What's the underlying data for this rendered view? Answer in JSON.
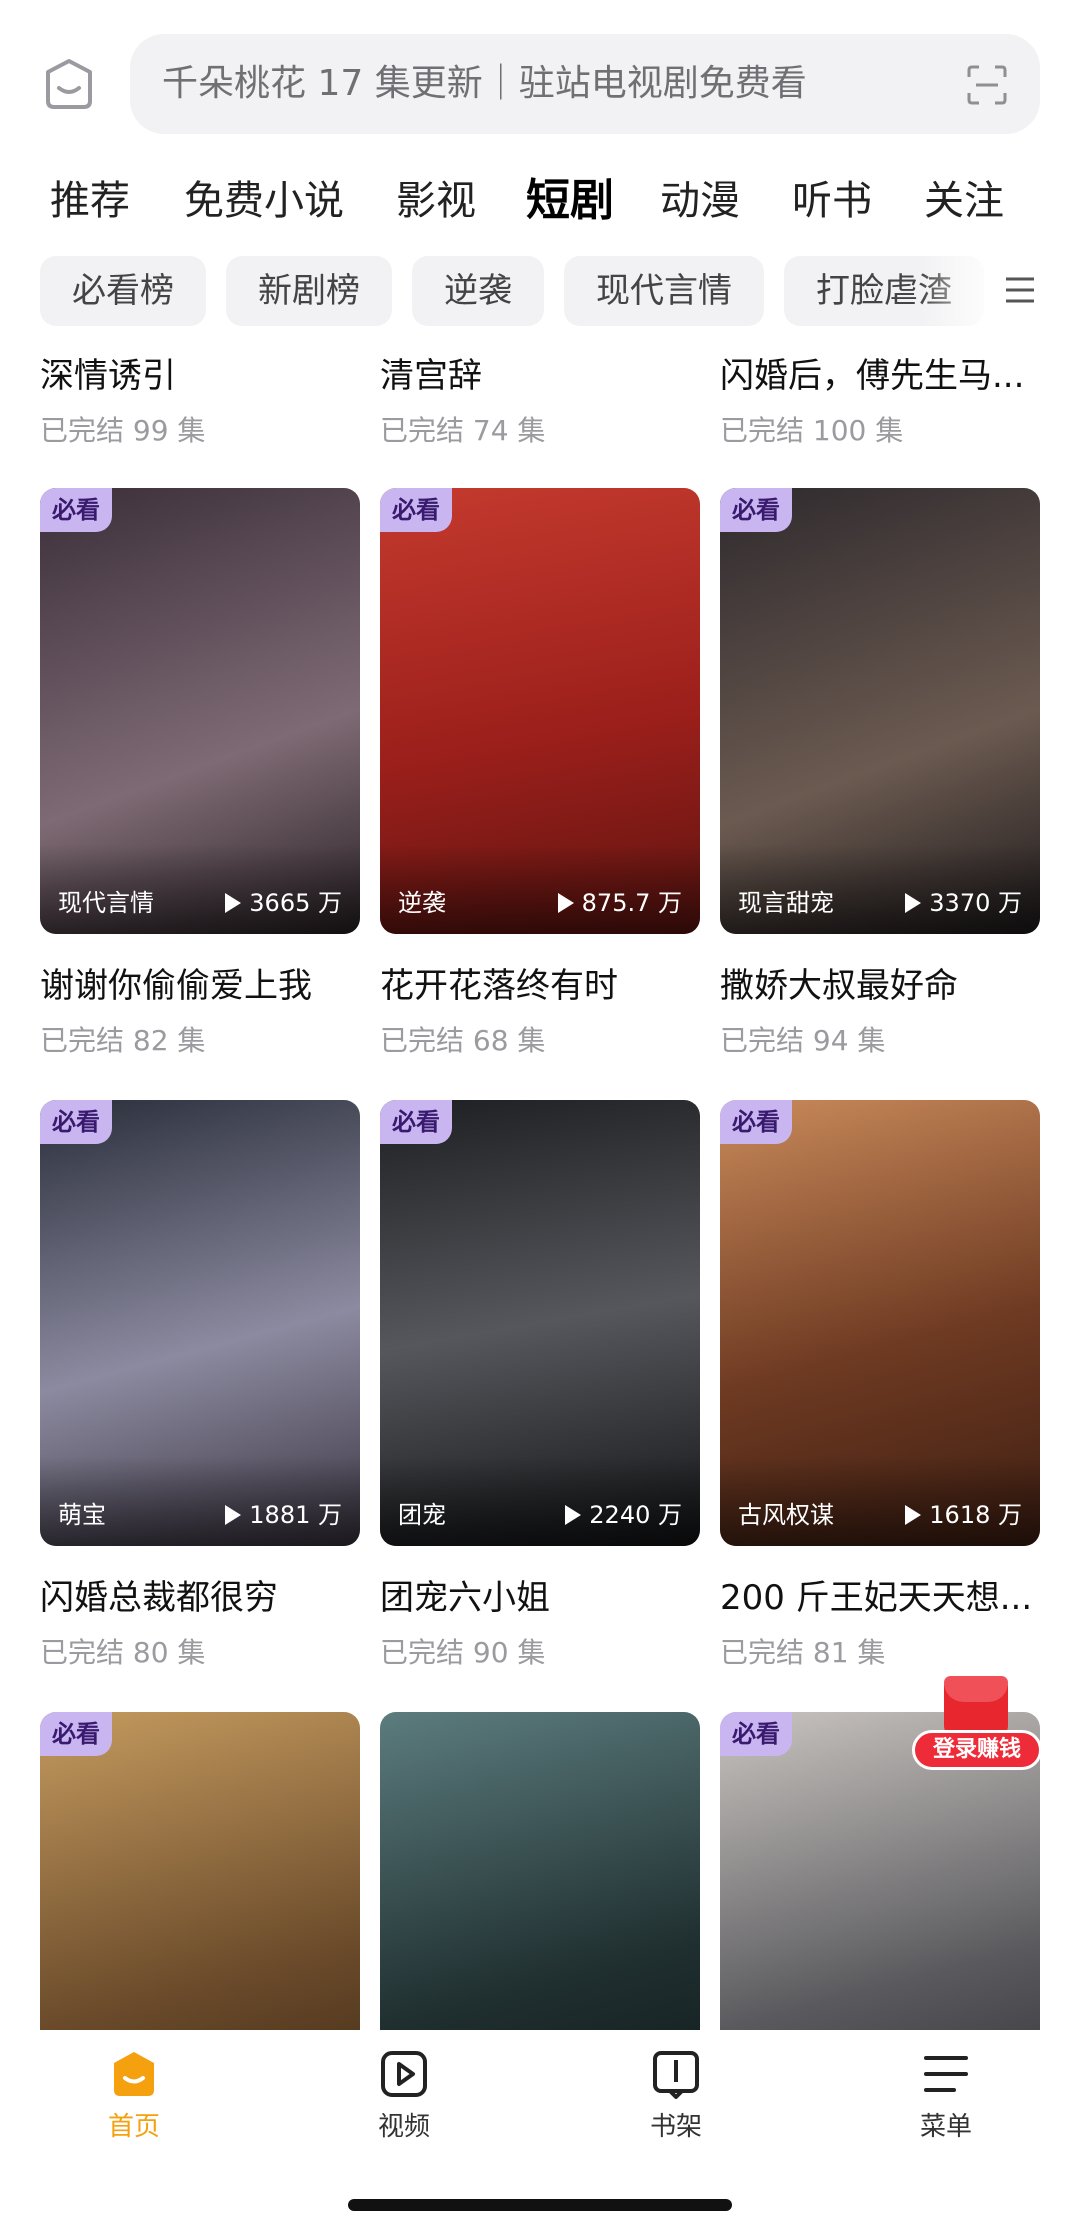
{
  "header": {
    "search_placeholder": "千朵桃花 17 集更新｜驻站电视剧免费看"
  },
  "tabs": [
    {
      "label": "推荐",
      "active": false
    },
    {
      "label": "免费小说",
      "active": false
    },
    {
      "label": "影视",
      "active": false
    },
    {
      "label": "短剧",
      "active": true
    },
    {
      "label": "动漫",
      "active": false
    },
    {
      "label": "听书",
      "active": false
    },
    {
      "label": "关注",
      "active": false
    }
  ],
  "chips": [
    "必看榜",
    "新剧榜",
    "逆袭",
    "现代言情",
    "打脸虐渣"
  ],
  "top_row": [
    {
      "title": "深情诱引",
      "meta": "已完结  99 集"
    },
    {
      "title": "清宫辞",
      "meta": "已完结  74 集"
    },
    {
      "title": "闪婚后，傅先生马...",
      "meta": "已完结  100 集"
    }
  ],
  "cards": [
    {
      "badge": "必看",
      "genre": "现代言情",
      "plays": "3665 万",
      "title": "谢谢你偷偷爱上我",
      "meta": "已完结  82 集",
      "colors": [
        "#3b2f3a",
        "#7e6a74"
      ]
    },
    {
      "badge": "必看",
      "genre": "逆袭",
      "plays": "875.7 万",
      "title": "花开花落终有时",
      "meta": "已完结  68 集",
      "colors": [
        "#9c1f1b",
        "#d9493a"
      ]
    },
    {
      "badge": "必看",
      "genre": "现言甜宠",
      "plays": "3370 万",
      "title": "撒娇大叔最好命",
      "meta": "已完结  94 集",
      "colors": [
        "#2f2a2e",
        "#6b5a50"
      ]
    },
    {
      "badge": "必看",
      "genre": "萌宝",
      "plays": "1881 万",
      "title": "闪婚总裁都很穷",
      "meta": "已完结  80 集",
      "colors": [
        "#2a2f3b",
        "#8c8aa0"
      ]
    },
    {
      "badge": "必看",
      "genre": "团宠",
      "plays": "2240 万",
      "title": "团宠六小姐",
      "meta": "已完结  90 集",
      "colors": [
        "#1d1f22",
        "#55575c"
      ]
    },
    {
      "badge": "必看",
      "genre": "古风权谋",
      "plays": "1618 万",
      "title": "200 斤王妃天天想...",
      "meta": "已完结  81 集",
      "colors": [
        "#6e3a22",
        "#c98a5a"
      ]
    }
  ],
  "bottom_cards": [
    {
      "badge": "必看",
      "colors": [
        "#6a4a2a",
        "#c49a5e"
      ]
    },
    {
      "badge": "",
      "colors": [
        "#1f2e2f",
        "#5c7c7e"
      ]
    },
    {
      "badge": "必看",
      "colors": [
        "#5a5a5e",
        "#c9c4c0"
      ]
    }
  ],
  "login_badge": "登录赚钱",
  "nav": [
    {
      "label": "首页",
      "icon": "home-icon",
      "active": true
    },
    {
      "label": "视频",
      "icon": "video-icon",
      "active": false
    },
    {
      "label": "书架",
      "icon": "bookshelf-icon",
      "active": false
    },
    {
      "label": "菜单",
      "icon": "menu-icon",
      "active": false
    }
  ],
  "colors": {
    "accent": "#f5a00f",
    "badge_bg": "#c9b6f1",
    "login_red": "#ee2b38"
  }
}
